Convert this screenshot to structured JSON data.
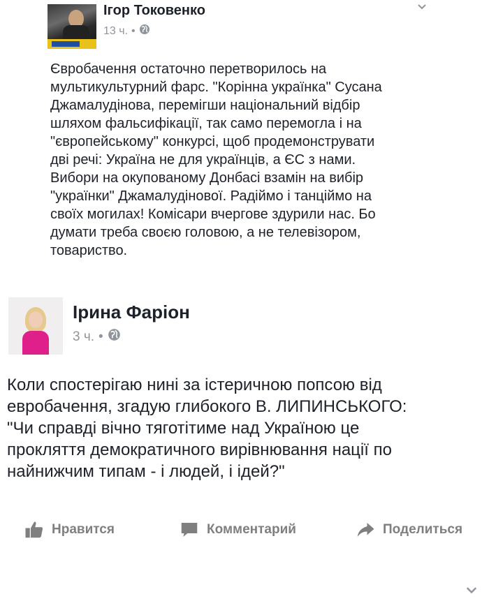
{
  "post1": {
    "author": "Ігор Токовенко",
    "time": "13 ч.",
    "dot": "•",
    "text": "Євробачення остаточно перетворилось на\nмультикультурний фарс. \"Корінна українка\" Сусана\nДжамалудінова, перемігши національний відбір\nшляхом фальсифікації, так само перемогла і на\n\"європейському\" конкурсі, щоб продемонструвати\nдві речі: Україна не для українців, а ЄС з нами.\nВибори на окупованому Донбасі взамін на вибір\n\"українки\" Джамалудінової. Радіймо і танціймо на\nсвоїх могилах! Комісари вчергове здурили нас. Бо\nдумати треба своєю головою, а не телевізором,\nтовариство."
  },
  "post2": {
    "author": "Ірина Фаріон",
    "time": "3 ч.",
    "dot": "•",
    "text": "Коли спостерігаю нині за істеричною попсою від\nевробачення, згадую глибокого В. ЛИПИНСЬКОГО:\n\"Чи справді вічно тяготітиме над Україною це\nпрокляття демократичного вирівнювання нації по\nнайнижчим типам - і людей, і ідей?\""
  },
  "actions": {
    "like": "Нравится",
    "comment": "Комментарий",
    "share": "Поделиться"
  },
  "colors": {
    "text": "#1d2129",
    "meta": "#90949c",
    "action": "#7f7f7f"
  }
}
